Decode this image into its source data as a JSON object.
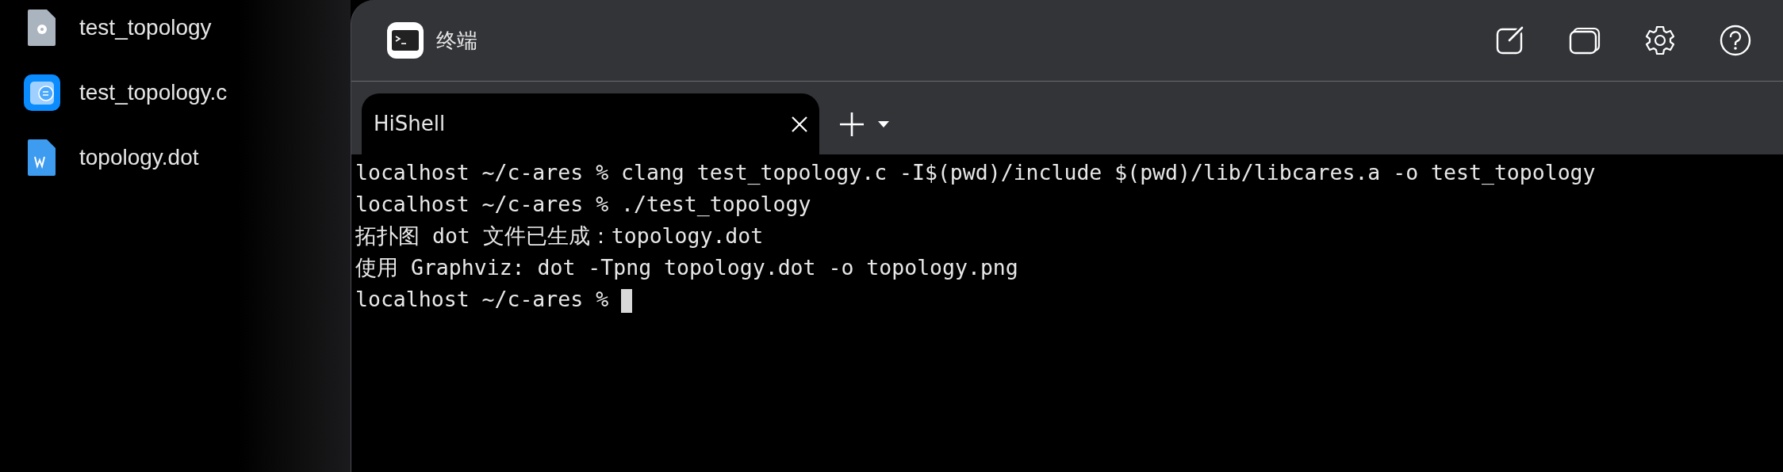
{
  "desktop_files": [
    {
      "name": "test_topology",
      "kind": "unknown"
    },
    {
      "name": "test_topology.c",
      "kind": "source"
    },
    {
      "name": "topology.dot",
      "kind": "document"
    }
  ],
  "window": {
    "title": "终端"
  },
  "tabs": [
    {
      "label": "HiShell",
      "selected": true
    }
  ],
  "terminal": {
    "lines": [
      "localhost ~/c-ares % clang test_topology.c -I$(pwd)/include $(pwd)/lib/libcares.a -o test_topology",
      "localhost ~/c-ares % ./test_topology",
      "拓扑图 dot 文件已生成：topology.dot",
      "使用 Graphviz: dot -Tpng topology.dot -o topology.png",
      "localhost ~/c-ares % "
    ]
  }
}
